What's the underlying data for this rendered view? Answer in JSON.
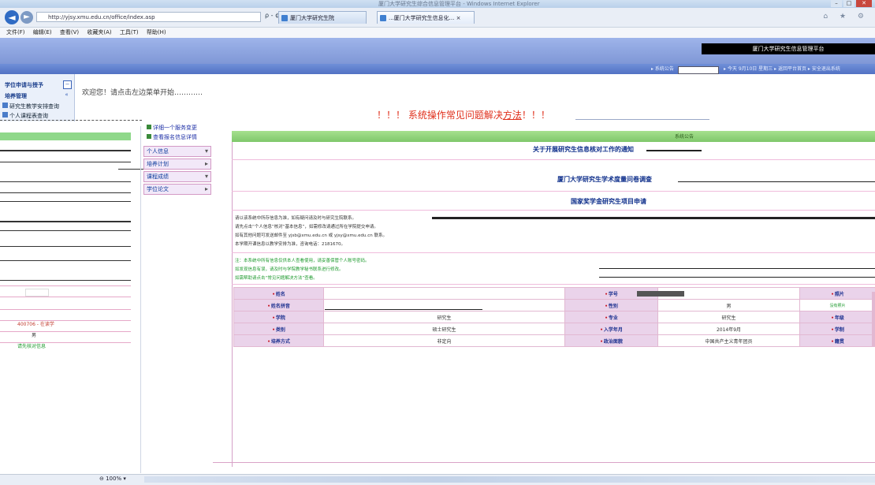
{
  "browser": {
    "window_title": "厦门大学研究生综合信息管理平台 - Windows Internet Explorer",
    "address": "http://yjsy.xmu.edu.cn/office/index.asp",
    "address_tools": "ρ - ¢",
    "tabs": [
      {
        "label": "厦门大学研究生院"
      },
      {
        "label": "...厦门大学研究生信息化...  ×"
      }
    ],
    "nav_right_icons": "⌂ ★ ⚙",
    "menu": [
      "文件(F)",
      "编辑(E)",
      "查看(V)",
      "收藏夹(A)",
      "工具(T)",
      "帮助(H)"
    ],
    "zoom": "⊖ 100%  ▾"
  },
  "site": {
    "brand": "厦门大学研究生信息管理平台",
    "toolbar": [
      "▸ 系统公告",
      "▸ 今天 9月10日 星期三 ▸ 返回平台首页 ▸ 安全退出系统"
    ]
  },
  "sidebar": {
    "items": [
      {
        "label": "学位申请与授予",
        "btn": "−"
      },
      {
        "label": "培养管理",
        "btn": "«"
      },
      {
        "label": "研究生教学安排查询"
      },
      {
        "label": "个人课程表查询"
      }
    ]
  },
  "welcome": "欢迎您！请点击左边菜单开始…………",
  "notice": {
    "prefix": "！！！ 系统操作常见问题解决",
    "link": "方法",
    "suffix": "！！！"
  },
  "middle_nav": {
    "links": [
      "详细一个服务变更",
      "查看报名信息详情"
    ],
    "buttons": [
      {
        "label": "个人信息",
        "arrow": "▾"
      },
      {
        "label": "培养计划",
        "arrow": "▸"
      },
      {
        "label": "课程成绩",
        "arrow": "▾"
      },
      {
        "label": "学位论文",
        "arrow": "▸"
      }
    ]
  },
  "panel": {
    "head": "系统公告",
    "title1": "关于开展研究生信息核对工作的通知",
    "title2": "厦门大学研究生学术度量问卷调查",
    "title3": "国家奖学金研究生项目申请",
    "lines": [
      "请以该系统中所存信息为准，如有疑问请及时与研究生院联系。",
      "请先点击“个人信息”核对“基本信息”，如需修改请通过所在学院提交申请。",
      "如有其他问题可发送邮件至 yjsb@xmu.edu.cn 或 yjsy@xmu.edu.cn 联系。",
      "本学期开课信息以教学安排为准，咨询电话：2181670。"
    ],
    "green_lines": [
      "注：本系统中所有信息仅供本人查看使用，请妥善保管个人账号密码。",
      "如发现信息有误，请及时与学院教学秘书联系进行修改。",
      "如需帮助请点击“常见问题解决方法”查看。"
    ]
  },
  "table": {
    "rows": [
      [
        {
          "t": "姓名",
          "k": "lb"
        },
        {
          "t": "",
          "k": "vl",
          "span": 2
        },
        {
          "t": "学号",
          "k": "lb"
        },
        {
          "t": "",
          "k": "vl",
          "span": 3
        },
        {
          "t": "照片",
          "k": "lb"
        }
      ],
      [
        {
          "t": "姓名拼音",
          "k": "lb"
        },
        {
          "t": "",
          "k": "vl",
          "span": 2
        },
        {
          "t": "性别",
          "k": "lb"
        },
        {
          "t": "男",
          "k": "vl",
          "span": 3
        },
        {
          "t": "没有照片",
          "k": "note"
        }
      ],
      [
        {
          "t": "学院",
          "k": "lb"
        },
        {
          "t": "研究生",
          "k": "vl",
          "span": 2
        },
        {
          "t": "专业",
          "k": "lb"
        },
        {
          "t": "研究生",
          "k": "vl",
          "span": 3
        },
        {
          "t": "年级",
          "k": "lb"
        }
      ],
      [
        {
          "t": "类别",
          "k": "lb"
        },
        {
          "t": "硕士研究生",
          "k": "vl",
          "span": 2
        },
        {
          "t": "入学年月",
          "k": "lb"
        },
        {
          "t": "2014年9月",
          "k": "vl",
          "span": 3
        },
        {
          "t": "学制",
          "k": "lb"
        }
      ],
      [
        {
          "t": "培养方式",
          "k": "lb"
        },
        {
          "t": "非定向",
          "k": "vl",
          "span": 2
        },
        {
          "t": "政治面貌",
          "k": "lb"
        },
        {
          "t": "中国共产主义青年团员",
          "k": "vl",
          "span": 3
        },
        {
          "t": "籍贯",
          "k": "lb"
        }
      ]
    ]
  },
  "left_misc": [
    {
      "t": "400706 - 在读学",
      "c": "#c0392b"
    },
    {
      "t": "男",
      "c": "#333333"
    },
    {
      "t": "请先核对信息",
      "c": "#1e9a2e"
    }
  ]
}
